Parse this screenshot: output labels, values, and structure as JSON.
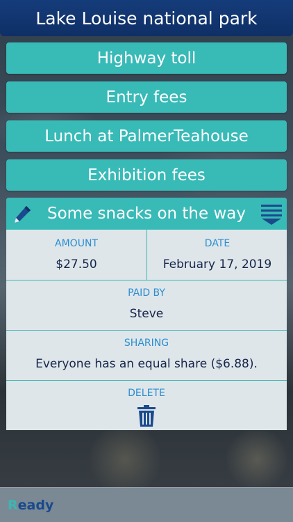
{
  "header": {
    "title": "Lake Louise national park"
  },
  "categories": [
    {
      "label": "Highway toll"
    },
    {
      "label": "Entry fees"
    },
    {
      "label": "Lunch at PalmerTeahouse"
    },
    {
      "label": "Exhibition fees"
    }
  ],
  "expense": {
    "title": "Some snacks on the way",
    "amount_label": "AMOUNT",
    "amount_value": "$27.50",
    "date_label": "DATE",
    "date_value": "February 17, 2019",
    "paid_by_label": "PAID BY",
    "paid_by_value": "Steve",
    "sharing_label": "SHARING",
    "sharing_value": "Everyone has an equal share ($6.88).",
    "delete_label": "DELETE"
  },
  "status": {
    "first_letter": "R",
    "rest": "eady"
  },
  "icons": {
    "edit": "pencil-icon",
    "menu": "menu-down-icon",
    "delete": "trash-icon"
  },
  "colors": {
    "header": "#153c7a",
    "teal": "#38bab7",
    "label_blue": "#2a8ed0",
    "value_dark": "#16264a",
    "panel_bg": "#dfe6ea"
  }
}
